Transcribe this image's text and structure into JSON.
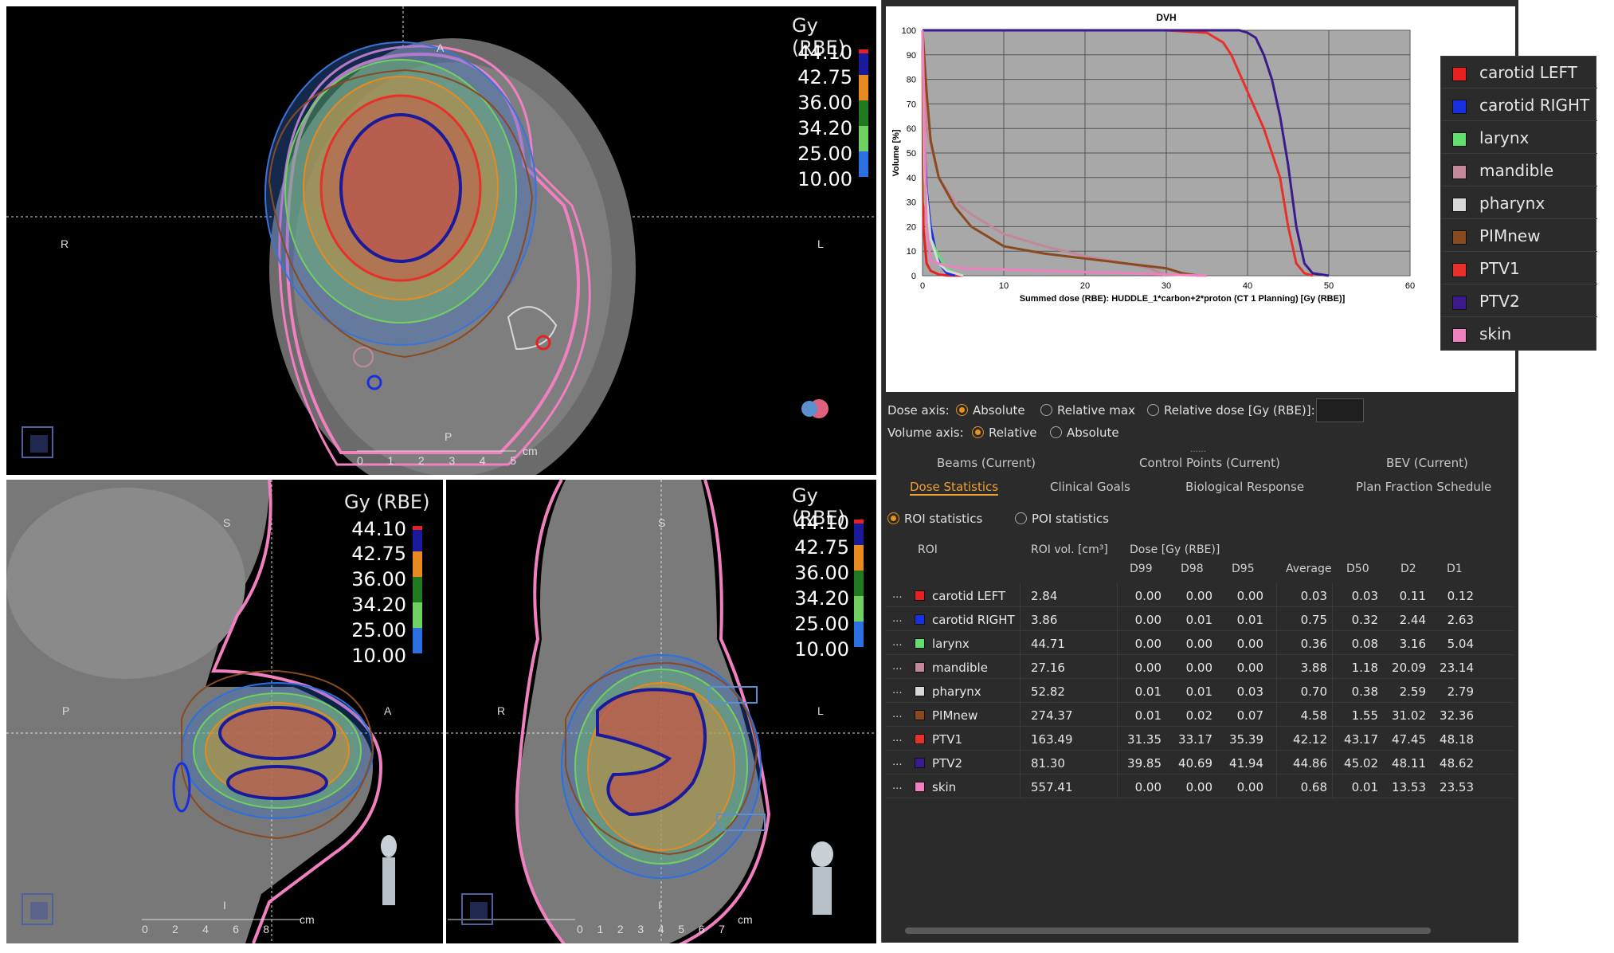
{
  "colors": {
    "ptv1": "#e8302a",
    "ptv2": "#3a1a8c",
    "carotid_left": "#e82020",
    "carotid_right": "#1830e0",
    "larynx": "#60e070",
    "mandible": "#c08898",
    "pharynx": "#d8d8d8",
    "pimnew": "#8a4a20",
    "skin": "#f080c0",
    "accent": "#e89020"
  },
  "viewports": {
    "axial": {
      "scale_title": "Gy (RBE)",
      "orient_top": "A",
      "orient_left": "R",
      "orient_right": "L",
      "orient_bottom": "P",
      "ruler_unit": "cm",
      "ruler_ticks": [
        "0",
        "1",
        "2",
        "3",
        "4",
        "5"
      ]
    },
    "sagittal": {
      "scale_title": "Gy (RBE)",
      "orient_top": "S",
      "orient_left": "P",
      "orient_right": "A",
      "orient_bottom": "I",
      "ruler_unit": "cm",
      "ruler_ticks": [
        "0",
        "2",
        "4",
        "6",
        "8"
      ]
    },
    "coronal": {
      "scale_title": "Gy (RBE)",
      "orient_top": "S",
      "orient_left": "R",
      "orient_right": "L",
      "orient_bottom": "I",
      "ruler_unit": "cm",
      "ruler_ticks": [
        "0",
        "1",
        "2",
        "3",
        "4",
        "5",
        "6",
        "7"
      ]
    }
  },
  "dose_scale": {
    "values": [
      "44.10",
      "42.75",
      "36.00",
      "34.20",
      "25.00",
      "10.00"
    ],
    "colors": [
      "#1a1a9c",
      "#e88a20",
      "#207a20",
      "#70d060",
      "#2a70e0"
    ]
  },
  "chart_data": {
    "type": "line",
    "title": "DVH",
    "xlabel": "Summed dose (RBE): HUDDLE_1*carbon+2*proton (CT 1 Planning) [Gy (RBE)]",
    "ylabel": "Volume [%]",
    "xlim": [
      0,
      60
    ],
    "ylim": [
      0,
      100
    ],
    "x_ticks": [
      "0",
      "10",
      "20",
      "30",
      "40",
      "50",
      "60"
    ],
    "y_ticks": [
      "0",
      "10",
      "20",
      "30",
      "40",
      "50",
      "60",
      "70",
      "80",
      "90",
      "100"
    ],
    "grid": true,
    "legend_position": "top-right",
    "series": [
      {
        "name": "carotid LEFT",
        "color": "#e82020",
        "x": [
          0,
          0.1,
          0.5,
          1,
          2,
          3,
          5
        ],
        "y": [
          100,
          20,
          5,
          2,
          0.5,
          0.1,
          0
        ]
      },
      {
        "name": "carotid RIGHT",
        "color": "#1830e0",
        "x": [
          0,
          0.2,
          0.5,
          1,
          1.5,
          2,
          2.5,
          3,
          4
        ],
        "y": [
          100,
          60,
          35,
          20,
          12,
          6,
          3,
          1,
          0
        ]
      },
      {
        "name": "larynx",
        "color": "#60e070",
        "x": [
          0,
          0.3,
          1,
          2,
          3,
          4,
          5
        ],
        "y": [
          100,
          30,
          15,
          8,
          3,
          1,
          0
        ]
      },
      {
        "name": "mandible",
        "color": "#c08898",
        "x": [
          0,
          0.5,
          2,
          4,
          6,
          10,
          15,
          20,
          25,
          28,
          30
        ],
        "y": [
          100,
          60,
          40,
          30,
          25,
          17,
          12,
          8,
          5,
          3,
          0
        ]
      },
      {
        "name": "pharynx",
        "color": "#d8d8d8",
        "x": [
          0,
          0.3,
          1,
          2,
          3,
          5
        ],
        "y": [
          100,
          40,
          15,
          5,
          2,
          0
        ]
      },
      {
        "name": "PIMnew",
        "color": "#8a4a20",
        "x": [
          0,
          0.5,
          1,
          2,
          4,
          6,
          10,
          15,
          20,
          25,
          30,
          32,
          34
        ],
        "y": [
          100,
          75,
          55,
          40,
          28,
          20,
          12,
          9,
          7,
          5,
          3,
          1,
          0
        ]
      },
      {
        "name": "PTV1",
        "color": "#e8302a",
        "x": [
          0,
          20,
          30,
          35,
          37,
          38,
          40,
          42,
          44,
          45,
          46,
          47,
          48
        ],
        "y": [
          100,
          100,
          100,
          99,
          95,
          90,
          75,
          60,
          40,
          20,
          5,
          1,
          0
        ]
      },
      {
        "name": "PTV2",
        "color": "#3a1a8c",
        "x": [
          0,
          30,
          39,
          40,
          41,
          42,
          43,
          44,
          45,
          46,
          47,
          48,
          50
        ],
        "y": [
          100,
          100,
          100,
          99,
          97,
          90,
          80,
          65,
          45,
          20,
          5,
          1,
          0
        ]
      },
      {
        "name": "skin",
        "color": "#f080c0",
        "x": [
          0,
          0.5,
          1,
          3,
          5,
          10,
          15,
          20,
          25,
          30,
          35
        ],
        "y": [
          100,
          20,
          6,
          4,
          3,
          2.5,
          2,
          1.5,
          1,
          0.5,
          0
        ]
      }
    ]
  },
  "dose_axis": {
    "label": "Dose axis:",
    "options": [
      "Absolute",
      "Relative max",
      "Relative dose [Gy (RBE)]:"
    ],
    "selected": 0
  },
  "volume_axis": {
    "label": "Volume axis:",
    "options": [
      "Relative",
      "Absolute"
    ],
    "selected": 0
  },
  "tabs_row1": [
    "Beams (Current)",
    "Control Points (Current)",
    "BEV (Current)"
  ],
  "tabs_row2": [
    "Dose Statistics",
    "Clinical Goals",
    "Biological Response",
    "Plan Fraction Schedule"
  ],
  "stats_mode": {
    "options": [
      "ROI statistics",
      "POI statistics"
    ],
    "selected": 0
  },
  "table": {
    "headers": {
      "roi": "ROI",
      "vol": "ROI vol. [cm³]",
      "dose": "Dose [Gy (RBE)]"
    },
    "subheaders": [
      "D99",
      "D98",
      "D95",
      "Average",
      "D50",
      "D2",
      "D1"
    ],
    "row_menu": "...",
    "rows": [
      {
        "name": "carotid LEFT",
        "color": "#e82020",
        "vol": "2.84",
        "d99": "0.00",
        "d98": "0.00",
        "d95": "0.00",
        "avg": "0.03",
        "d50": "0.03",
        "d2": "0.11",
        "d1": "0.12"
      },
      {
        "name": "carotid RIGHT",
        "color": "#1830e0",
        "vol": "3.86",
        "d99": "0.00",
        "d98": "0.01",
        "d95": "0.01",
        "avg": "0.75",
        "d50": "0.32",
        "d2": "2.44",
        "d1": "2.63"
      },
      {
        "name": "larynx",
        "color": "#60e070",
        "vol": "44.71",
        "d99": "0.00",
        "d98": "0.00",
        "d95": "0.00",
        "avg": "0.36",
        "d50": "0.08",
        "d2": "3.16",
        "d1": "5.04"
      },
      {
        "name": "mandible",
        "color": "#c08898",
        "vol": "27.16",
        "d99": "0.00",
        "d98": "0.00",
        "d95": "0.00",
        "avg": "3.88",
        "d50": "1.18",
        "d2": "20.09",
        "d1": "23.14"
      },
      {
        "name": "pharynx",
        "color": "#d8d8d8",
        "vol": "52.82",
        "d99": "0.01",
        "d98": "0.01",
        "d95": "0.03",
        "avg": "0.70",
        "d50": "0.38",
        "d2": "2.59",
        "d1": "2.79"
      },
      {
        "name": "PIMnew",
        "color": "#8a4a20",
        "vol": "274.37",
        "d99": "0.01",
        "d98": "0.02",
        "d95": "0.07",
        "avg": "4.58",
        "d50": "1.55",
        "d2": "31.02",
        "d1": "32.36"
      },
      {
        "name": "PTV1",
        "color": "#e8302a",
        "vol": "163.49",
        "d99": "31.35",
        "d98": "33.17",
        "d95": "35.39",
        "avg": "42.12",
        "d50": "43.17",
        "d2": "47.45",
        "d1": "48.18"
      },
      {
        "name": "PTV2",
        "color": "#3a1a8c",
        "vol": "81.30",
        "d99": "39.85",
        "d98": "40.69",
        "d95": "41.94",
        "avg": "44.86",
        "d50": "45.02",
        "d2": "48.11",
        "d1": "48.62"
      },
      {
        "name": "skin",
        "color": "#f080c0",
        "vol": "557.41",
        "d99": "0.00",
        "d98": "0.00",
        "d95": "0.00",
        "avg": "0.68",
        "d50": "0.01",
        "d2": "13.53",
        "d1": "23.53"
      }
    ]
  }
}
